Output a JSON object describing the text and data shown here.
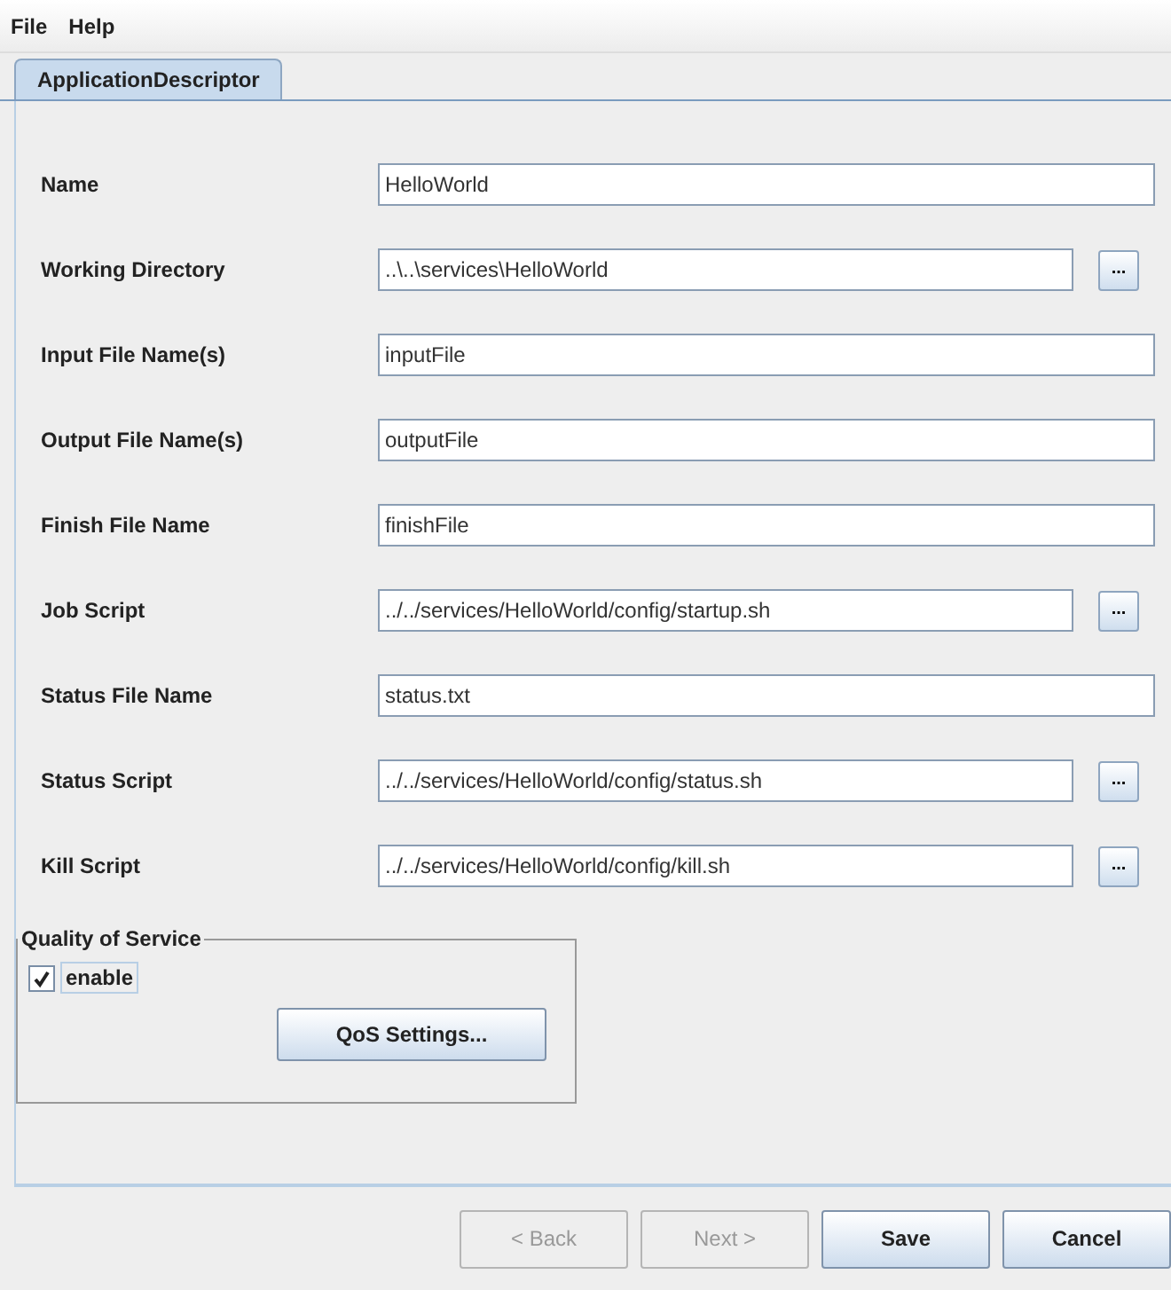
{
  "menu": [
    "File",
    "Help"
  ],
  "tabs": [
    {
      "label": "ApplicationDescriptor",
      "selected": true
    }
  ],
  "fields": [
    {
      "label": "Name",
      "value": "HelloWorld",
      "browse": false
    },
    {
      "label": "Working Directory",
      "value": "..\\..\\services\\HelloWorld",
      "browse": true
    },
    {
      "label": "Input File Name(s)",
      "value": "inputFile",
      "browse": false
    },
    {
      "label": "Output File Name(s)",
      "value": "outputFile",
      "browse": false
    },
    {
      "label": "Finish File Name",
      "value": "finishFile",
      "browse": false
    },
    {
      "label": "Job Script",
      "value": "../../services/HelloWorld/config/startup.sh",
      "browse": true
    },
    {
      "label": "Status File Name",
      "value": "status.txt",
      "browse": false
    },
    {
      "label": "Status Script",
      "value": "../../services/HelloWorld/config/status.sh",
      "browse": true
    },
    {
      "label": "Kill Script",
      "value": "../../services/HelloWorld/config/kill.sh",
      "browse": true
    }
  ],
  "browse_label": "...",
  "qos": {
    "title": "Quality of Service",
    "enable": {
      "label": "enable",
      "checked": true
    },
    "button": "QoS Settings..."
  },
  "buttons": [
    {
      "label": "< Back",
      "disabled": true
    },
    {
      "label": "Next >",
      "disabled": true
    },
    {
      "label": "Save",
      "disabled": false
    },
    {
      "label": "Cancel",
      "disabled": false
    }
  ]
}
